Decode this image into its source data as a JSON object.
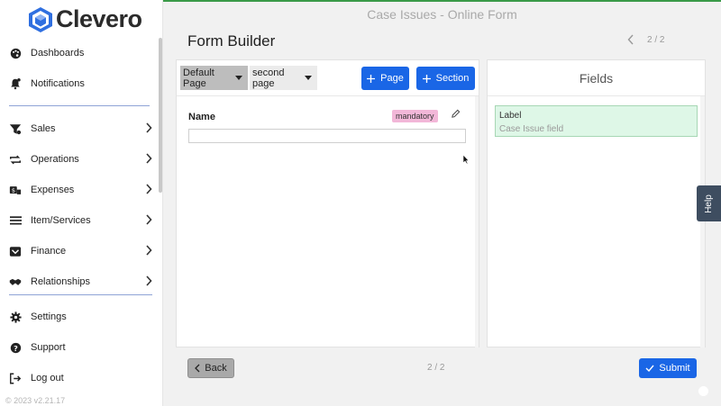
{
  "brand": {
    "name": "Clevero",
    "version": "© 2023 v2.21.17"
  },
  "sidebar": {
    "items": [
      {
        "label": "Dashboards",
        "icon": "palette-icon"
      },
      {
        "label": "Notifications",
        "icon": "bell-icon"
      },
      {
        "label": "Sales",
        "icon": "funnel-icon"
      },
      {
        "label": "Operations",
        "icon": "repeat-icon"
      },
      {
        "label": "Expenses",
        "icon": "money-icon"
      },
      {
        "label": "Item/Services",
        "icon": "list-icon"
      },
      {
        "label": "Finance",
        "icon": "inbox-icon"
      },
      {
        "label": "Relationships",
        "icon": "handshake-icon"
      },
      {
        "label": "Settings",
        "icon": "gear-icon"
      },
      {
        "label": "Support",
        "icon": "question-icon"
      },
      {
        "label": "Log out",
        "icon": "logout-icon"
      }
    ]
  },
  "header": {
    "title": "Case Issues - Online Form"
  },
  "main": {
    "heading": "Form Builder",
    "pager": "2 / 2",
    "pages": [
      {
        "label": "Default Page",
        "active": true
      },
      {
        "label": "second page",
        "active": false
      }
    ],
    "add_page_label": "Page",
    "add_section_label": "Section",
    "field": {
      "label": "Name",
      "badge": "mandatory"
    }
  },
  "fields_panel": {
    "title": "Fields",
    "items": [
      {
        "label": "Label",
        "hint": "Case Issue field"
      }
    ]
  },
  "footer": {
    "back_label": "Back",
    "pager": "2 / 2",
    "submit_label": "Submit"
  },
  "help_label": "Help",
  "colors": {
    "primary": "#1a66e6",
    "field_card": "#def7e7",
    "badge": "#f2b7d8",
    "help": "#3e4d60"
  }
}
